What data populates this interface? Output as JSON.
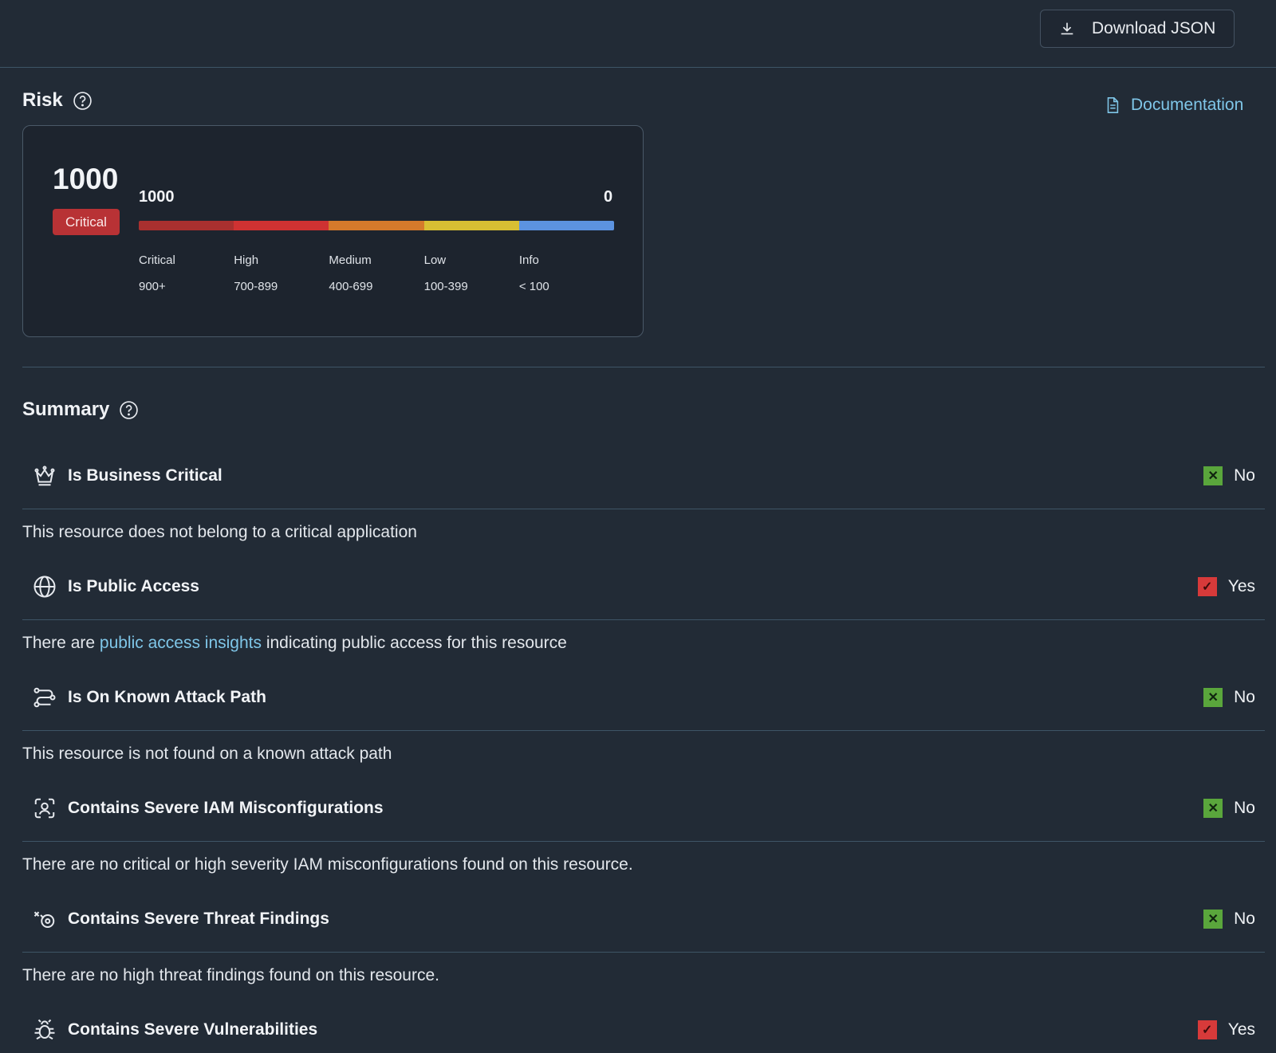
{
  "header": {
    "download_label": "Download JSON"
  },
  "risk": {
    "title": "Risk",
    "documentation_label": "Documentation",
    "score": "1000",
    "severity": "Critical",
    "scale_max": "1000",
    "scale_min": "0",
    "bands": [
      {
        "label": "Critical",
        "range": "900+",
        "color": "#a9302f"
      },
      {
        "label": "High",
        "range": "700-899",
        "color": "#cf3232"
      },
      {
        "label": "Medium",
        "range": "400-699",
        "color": "#d57a2b"
      },
      {
        "label": "Low",
        "range": "100-399",
        "color": "#d8bf33"
      },
      {
        "label": "Info",
        "range": "< 100",
        "color": "#5c93e0"
      }
    ]
  },
  "summary": {
    "title": "Summary",
    "items": [
      {
        "label": "Is Business Critical",
        "icon": "crown-icon",
        "value": "No",
        "state": "no",
        "desc": "This resource does not belong to a critical application"
      },
      {
        "label": "Is Public Access",
        "icon": "globe-icon",
        "value": "Yes",
        "state": "yes",
        "desc_prefix": "There are ",
        "desc_link": "public access insights",
        "desc_suffix": " indicating public access for this resource"
      },
      {
        "label": "Is On Known Attack Path",
        "icon": "route-icon",
        "value": "No",
        "state": "no",
        "desc": "This resource is not found on a known attack path"
      },
      {
        "label": "Contains Severe IAM Misconfigurations",
        "icon": "user-scan-icon",
        "value": "No",
        "state": "no",
        "desc": "There are no critical or high severity IAM misconfigurations found on this resource."
      },
      {
        "label": "Contains Severe Threat Findings",
        "icon": "threat-icon",
        "value": "No",
        "state": "no",
        "desc": "There are no high threat findings found on this resource."
      },
      {
        "label": "Contains Severe Vulnerabilities",
        "icon": "bug-icon",
        "value": "Yes",
        "state": "yes"
      }
    ]
  },
  "colors": {
    "accent_link": "#7fc6e8",
    "no": "#5aa63c",
    "yes": "#d73a3a",
    "critical_badge": "#b83235"
  }
}
